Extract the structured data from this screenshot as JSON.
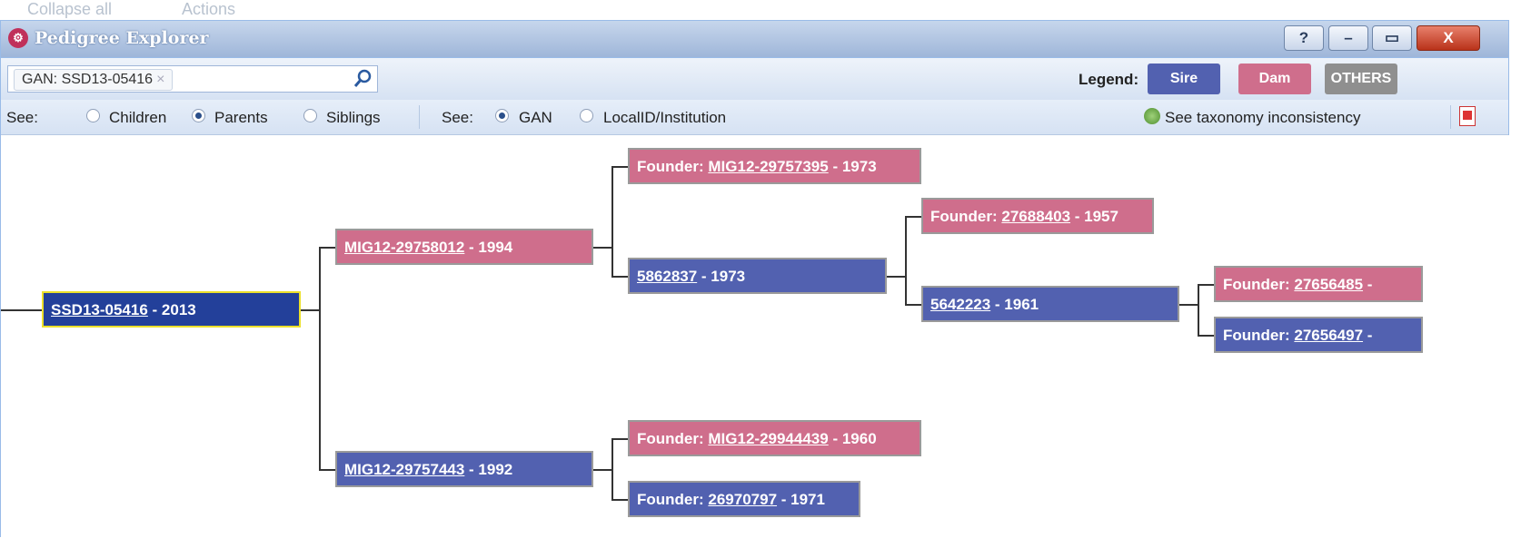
{
  "background": {
    "collapse_label": "Collapse all",
    "actions_label": "Actions"
  },
  "window": {
    "title": "Pedigree Explorer",
    "buttons": {
      "help": "?",
      "minimize": "–",
      "maximize": "▭",
      "close": "X"
    }
  },
  "search": {
    "tag": "GAN: SSD13-05416",
    "tag_remove": "×"
  },
  "legend": {
    "label": "Legend:",
    "sire": "Sire",
    "dam": "Dam",
    "others": "OTHERS"
  },
  "relation": {
    "see_label": "See:",
    "options": [
      "Children",
      "Parents",
      "Siblings"
    ],
    "selected": "Parents"
  },
  "id_mode": {
    "see_label": "See:",
    "options": [
      "GAN",
      "LocalID/Institution"
    ],
    "selected": "GAN"
  },
  "taxonomy_label": "See taxonomy inconsistency",
  "tree": {
    "root": {
      "id": "SSD13-05416",
      "suffix": " - 2013"
    },
    "dam": {
      "id": "MIG12-29758012",
      "suffix": " - 1994"
    },
    "sire": {
      "id": "MIG12-29757443",
      "suffix": " - 1992"
    },
    "dam_dam": {
      "prefix": "Founder: ",
      "id": "MIG12-29757395",
      "suffix": " - 1973"
    },
    "dam_sire": {
      "id": "5862837",
      "suffix": " - 1973"
    },
    "sire_dam": {
      "prefix": "Founder: ",
      "id": "MIG12-29944439",
      "suffix": " - 1960"
    },
    "sire_sire": {
      "prefix": "Founder: ",
      "id": "26970797",
      "suffix": " - 1971"
    },
    "ds_dam": {
      "prefix": "Founder: ",
      "id": "27688403",
      "suffix": " - 1957"
    },
    "ds_sire": {
      "id": "5642223",
      "suffix": " - 1961"
    },
    "dss_dam": {
      "prefix": "Founder: ",
      "id": "27656485",
      "suffix": " -"
    },
    "dss_sire": {
      "prefix": "Founder: ",
      "id": "27656497",
      "suffix": " -"
    }
  },
  "colors": {
    "sire": "#5261b0",
    "dam": "#cf6e8c",
    "others": "#8f8f8f",
    "root_border": "#ece02a"
  }
}
